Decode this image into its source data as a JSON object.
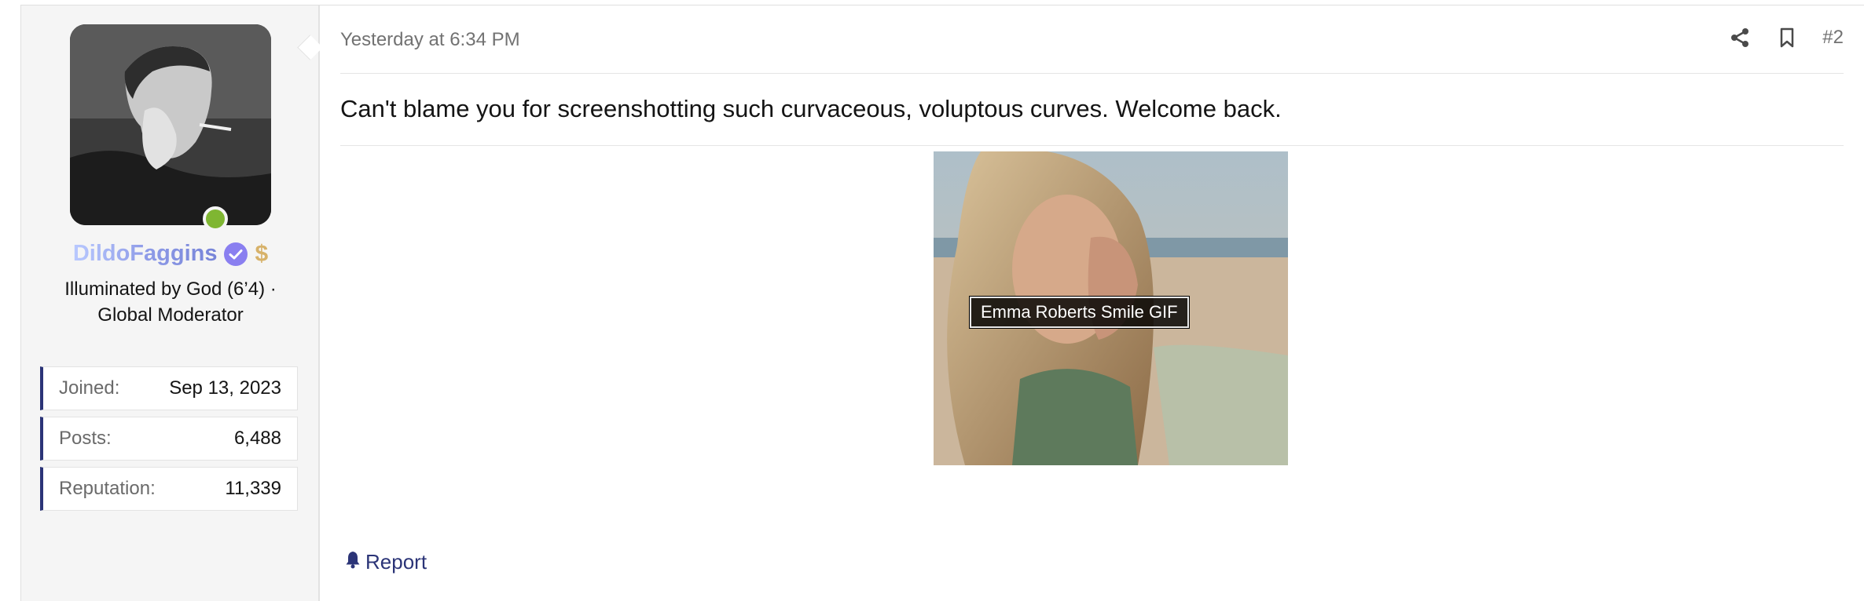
{
  "user": {
    "username": "DildoFaggins",
    "user_title": "Illuminated by God (6’4) · Global Moderator",
    "badge_symbol": "$",
    "online": true,
    "stats": [
      {
        "key": "Joined:",
        "value": "Sep 13, 2023"
      },
      {
        "key": "Posts:",
        "value": "6,488"
      },
      {
        "key": "Reputation:",
        "value": "11,339"
      }
    ]
  },
  "post": {
    "timestamp": "Yesterday at 6:34 PM",
    "post_number": "#2",
    "message": "Can't blame you for screenshotting such curvaceous, voluptous curves. Welcome back.",
    "gif_caption": "Emma Roberts Smile GIF",
    "report_label": "Report"
  },
  "colors": {
    "accent": "#2b3477",
    "online": "#7fb632",
    "verified": "#8a7ff0",
    "badge_gold": "#d7b26a"
  }
}
